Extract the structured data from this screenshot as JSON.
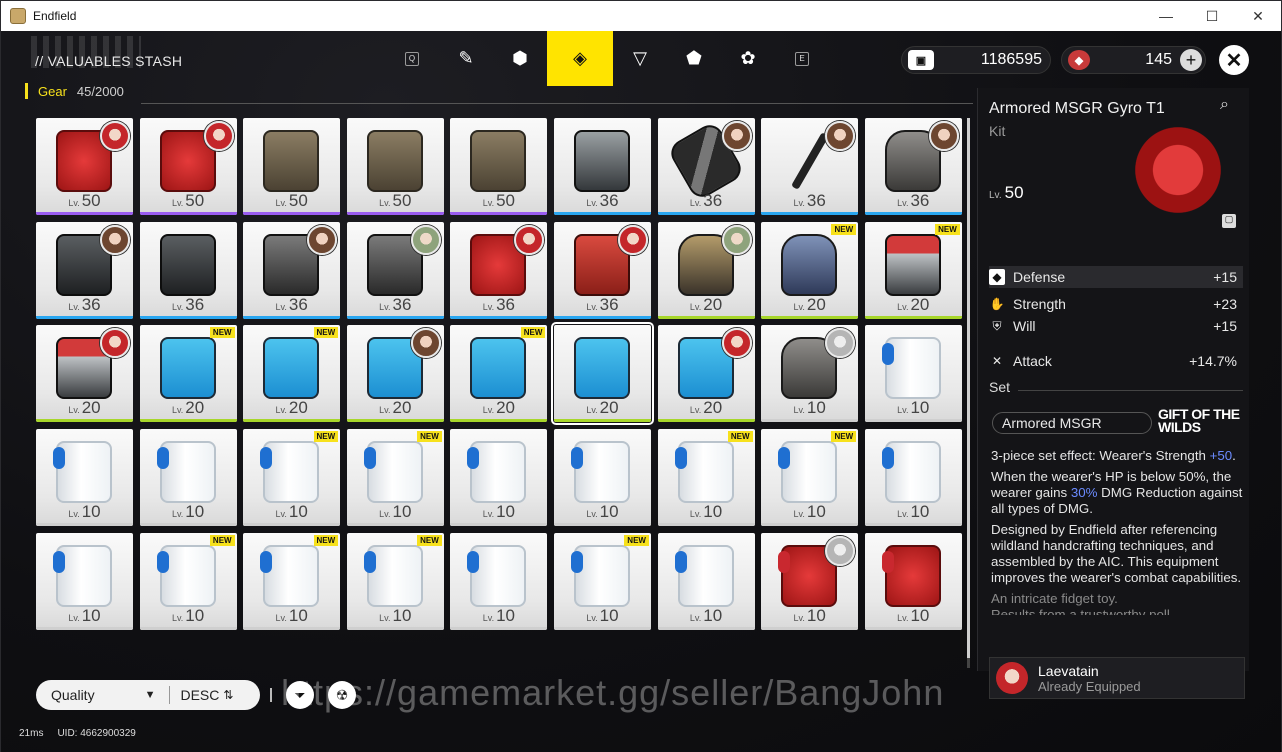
{
  "window": {
    "title": "Endfield",
    "min": "—",
    "max": "☐",
    "close": "✕"
  },
  "header": {
    "stash_title": "// VALUABLES STASH",
    "category": "Gear",
    "count": "45/2000",
    "tabs": [
      {
        "name": "tab-key-q",
        "label": "Q"
      },
      {
        "name": "tab-weapons",
        "label": "✎"
      },
      {
        "name": "tab-materials",
        "label": "⬢"
      },
      {
        "name": "tab-gear",
        "label": "◈"
      },
      {
        "name": "tab-consumables",
        "label": "▽"
      },
      {
        "name": "tab-special",
        "label": "⬟"
      },
      {
        "name": "tab-misc",
        "label": "✿"
      },
      {
        "name": "tab-key-e",
        "label": "E"
      }
    ],
    "currency1": "1186595",
    "currency2": "145",
    "close_label": "✕"
  },
  "grid": [
    {
      "art": "red",
      "lv": "50",
      "rarity": "purple",
      "avatar": "av-red",
      "sel": false
    },
    {
      "art": "red",
      "lv": "50",
      "rarity": "purple",
      "avatar": "av-red"
    },
    {
      "art": "tan",
      "lv": "50",
      "rarity": "purple"
    },
    {
      "art": "tan",
      "lv": "50",
      "rarity": "purple"
    },
    {
      "art": "tan",
      "lv": "50",
      "rarity": "purple"
    },
    {
      "art": "pack",
      "lv": "36",
      "rarity": "blue"
    },
    {
      "art": "pipe",
      "lv": "36",
      "rarity": "blue",
      "avatar": "av-brown"
    },
    {
      "art": "staff",
      "lv": "36",
      "rarity": "blue",
      "avatar": "av-brown"
    },
    {
      "art": "glove",
      "lv": "36",
      "rarity": "blue",
      "avatar": "av-brown"
    },
    {
      "art": "darkvest",
      "lv": "36",
      "rarity": "blue",
      "avatar": "av-brown"
    },
    {
      "art": "darkvest",
      "lv": "36",
      "rarity": "blue"
    },
    {
      "art": "grey",
      "lv": "36",
      "rarity": "blue",
      "avatar": "av-brown"
    },
    {
      "art": "grey",
      "lv": "36",
      "rarity": "blue",
      "avatar": "av-green"
    },
    {
      "art": "red",
      "lv": "36",
      "rarity": "blue",
      "avatar": "av-red"
    },
    {
      "art": "redjacket",
      "lv": "36",
      "rarity": "blue",
      "avatar": "av-red"
    },
    {
      "art": "glove-tan",
      "lv": "20",
      "rarity": "green",
      "avatar": "av-green"
    },
    {
      "art": "glove-blue",
      "lv": "20",
      "rarity": "green",
      "new": true
    },
    {
      "art": "pack-red",
      "lv": "20",
      "rarity": "green",
      "new": true
    },
    {
      "art": "pack-red",
      "lv": "20",
      "rarity": "green",
      "avatar": "av-red"
    },
    {
      "art": "jacket-blue",
      "lv": "20",
      "rarity": "green",
      "new": true
    },
    {
      "art": "jacket-blue",
      "lv": "20",
      "rarity": "green",
      "new": true
    },
    {
      "art": "jacket-blue",
      "lv": "20",
      "rarity": "green",
      "avatar": "av-brown"
    },
    {
      "art": "jacket-blue",
      "lv": "20",
      "rarity": "green",
      "new": true
    },
    {
      "art": "jacket-blue",
      "lv": "20",
      "rarity": "green",
      "sel": true
    },
    {
      "art": "jacket-blue",
      "lv": "20",
      "rarity": "green",
      "avatar": "av-red"
    },
    {
      "art": "glove",
      "lv": "10",
      "rarity": "none",
      "avatar": "av-grey"
    },
    {
      "art": "vest-white",
      "lv": "10",
      "rarity": "none"
    },
    {
      "art": "vest-white",
      "lv": "10",
      "rarity": "none"
    },
    {
      "art": "vest-white",
      "lv": "10",
      "rarity": "none"
    },
    {
      "art": "vest-white",
      "lv": "10",
      "rarity": "none",
      "new": true
    },
    {
      "art": "vest-white",
      "lv": "10",
      "rarity": "none",
      "new": true
    },
    {
      "art": "vest-white",
      "lv": "10",
      "rarity": "none"
    },
    {
      "art": "vest-white",
      "lv": "10",
      "rarity": "none"
    },
    {
      "art": "vest-white",
      "lv": "10",
      "rarity": "none",
      "new": true
    },
    {
      "art": "vest-white",
      "lv": "10",
      "rarity": "none",
      "new": true
    },
    {
      "art": "vest-white",
      "lv": "10",
      "rarity": "none"
    },
    {
      "art": "vest-white",
      "lv": "10",
      "rarity": "none"
    },
    {
      "art": "vest-white",
      "lv": "10",
      "rarity": "none",
      "new": true
    },
    {
      "art": "vest-white",
      "lv": "10",
      "rarity": "none",
      "new": true
    },
    {
      "art": "vest-white",
      "lv": "10",
      "rarity": "none",
      "new": true
    },
    {
      "art": "vest-white",
      "lv": "10",
      "rarity": "none"
    },
    {
      "art": "vest-white",
      "lv": "10",
      "rarity": "none",
      "new": true
    },
    {
      "art": "vest-white",
      "lv": "10",
      "rarity": "none"
    },
    {
      "art": "vest-white red",
      "lv": "10",
      "rarity": "none",
      "avatar": "av-grey"
    },
    {
      "art": "vest-white red",
      "lv": "10",
      "rarity": "none"
    }
  ],
  "lv_prefix": "Lv.",
  "new_label": "NEW",
  "detail": {
    "name": "Armored MSGR Gyro T1",
    "type": "Kit",
    "lv_prefix": "Lv.",
    "level": "50",
    "main_stat": {
      "label": "Defense",
      "value": "+15"
    },
    "stats": [
      {
        "name": "strength",
        "label": "Strength",
        "value": "+23",
        "icon": "✋"
      },
      {
        "name": "will",
        "label": "Will",
        "value": "+15",
        "icon": "⛨"
      },
      {
        "name": "attack",
        "label": "Attack",
        "value": "+14.7%",
        "icon": "✕"
      }
    ],
    "set_label": "Set",
    "set_name": "Armored MSGR",
    "set_brand": "GIFT OF THE WILDS",
    "effect1_a": "3-piece set effect: Wearer's Strength",
    "effect1_hl": "+50",
    "effect1_c": ".",
    "effect2_a": "When the wearer's HP is below 50%, the wearer gains ",
    "effect2_hl": "30%",
    "effect2_c": " DMG Reduction against all types of DMG.",
    "lore": "Designed by Endfield after referencing wildland handcrafting techniques, and assembled by the AIC. This equipment improves the wearer's combat capabilities.",
    "flavor1": "An intricate fidget toy.",
    "flavor2": "Results from a trustworthy poll",
    "equipped_name": "Laevatain",
    "equipped_status": "Already Equipped"
  },
  "bottom": {
    "sort": "Quality",
    "order": "DESC"
  },
  "watermark": "https://gamemarket.gg/seller/BangJohn",
  "status": {
    "ping": "21ms",
    "uid": "UID: 4662900329"
  }
}
